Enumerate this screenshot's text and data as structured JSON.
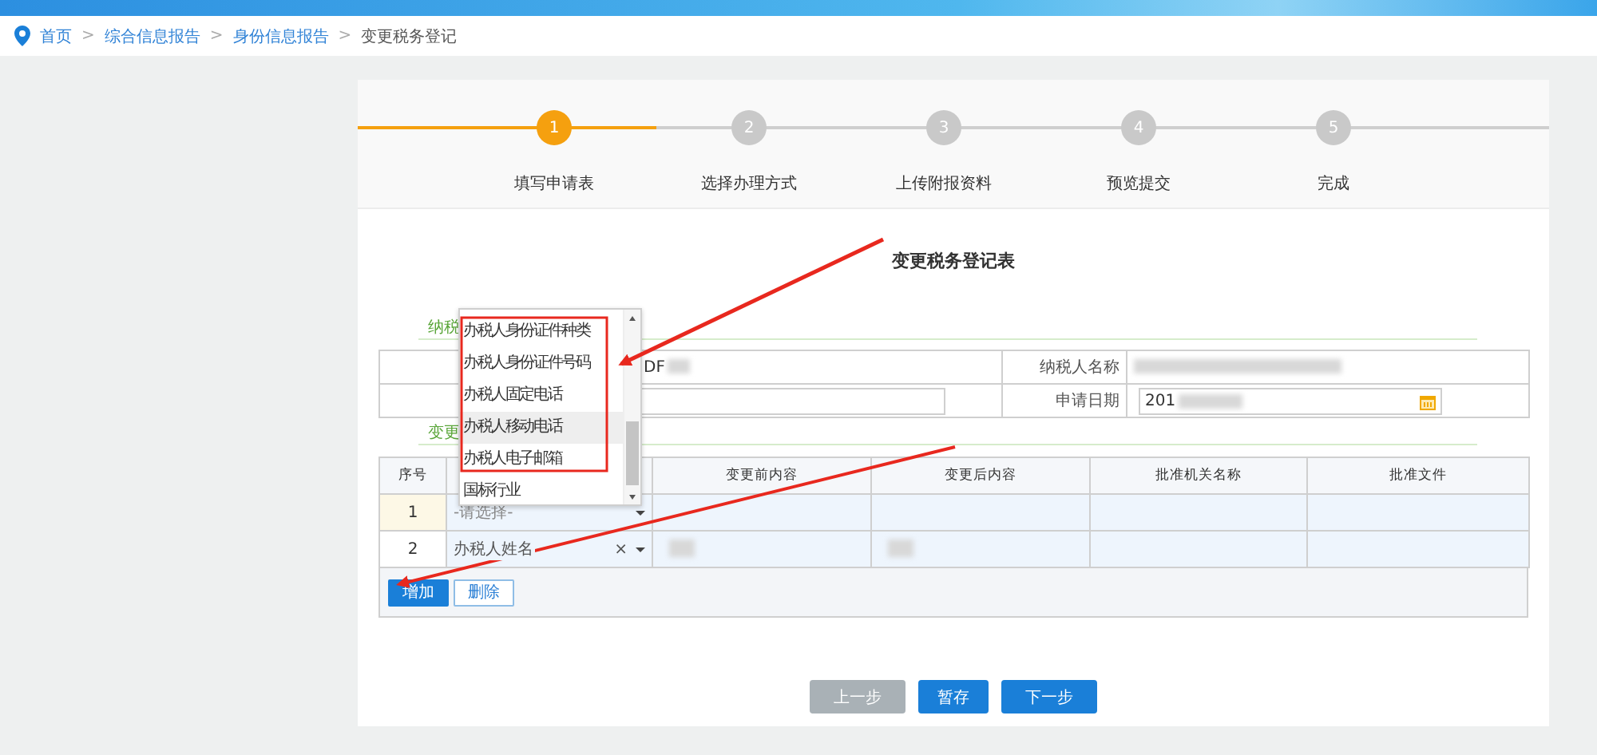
{
  "breadcrumb": [
    {
      "label": "首页",
      "current": false,
      "separator": ">"
    },
    {
      "label": "综合信息报告",
      "current": false,
      "separator": ">"
    },
    {
      "label": "身份信息报告",
      "current": false,
      "separator": ">"
    },
    {
      "label": "变更税务登记",
      "current": true
    }
  ],
  "steps": [
    {
      "number": "1",
      "label": "填写申请表",
      "selected": true
    },
    {
      "number": "2",
      "label": "选择办理方式",
      "selected": false
    },
    {
      "number": "3",
      "label": "上传附报资料",
      "selected": false
    },
    {
      "number": "4",
      "label": "预览提交",
      "selected": false
    },
    {
      "number": "5",
      "label": "完成",
      "selected": false
    }
  ],
  "form": {
    "title": "变更税务登记表",
    "section_1": "纳税",
    "info_rows": [
      {
        "kind": "text",
        "value_1": "DF",
        "label_2": "纳税人名称"
      },
      {
        "kind": "input",
        "label_2": "申请日期",
        "value_2": "201"
      }
    ],
    "section_2": "变更",
    "columns": [
      "序号",
      "变更前内容",
      "变更后内容",
      "批准机关名称",
      "批准文件"
    ],
    "rows": [
      {
        "number": "1",
        "placeholder": "-请选择-",
        "selected": true,
        "blurred": false
      },
      {
        "number": "2",
        "value": "办税人姓名",
        "clear": "×",
        "selected": false,
        "blurred": true
      }
    ],
    "row_buttons": [
      {
        "label": "增加",
        "kind": "primary"
      },
      {
        "label": "删除",
        "kind": "outline"
      }
    ]
  },
  "dropdown": {
    "options": [
      {
        "label": "办税人身份证件种类",
        "selected": false
      },
      {
        "label": "办税人身份证件号码",
        "selected": false
      },
      {
        "label": "办税人固定电话",
        "selected": false
      },
      {
        "label": "办税人移动电话",
        "selected": true
      },
      {
        "label": "办税人电子邮箱",
        "selected": false
      },
      {
        "label": "国标行业",
        "selected": false
      }
    ]
  },
  "footer_buttons": [
    {
      "label": "上一步",
      "disabled": true
    },
    {
      "label": "暂存",
      "disabled": false
    },
    {
      "label": "下一步",
      "disabled": false
    }
  ]
}
